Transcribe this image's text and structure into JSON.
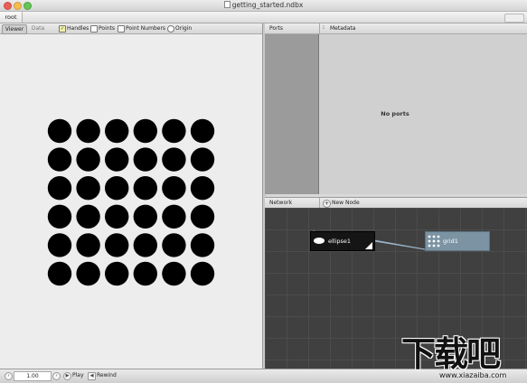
{
  "window": {
    "title": "getting_started.ndbx"
  },
  "pathbar": {
    "root": "root"
  },
  "viewer": {
    "tabs": [
      "Viewer",
      "Data"
    ],
    "options": [
      {
        "label": "Handles",
        "checked": true
      },
      {
        "label": "Points",
        "checked": false
      },
      {
        "label": "Point Numbers",
        "checked": false
      },
      {
        "label": "Origin",
        "checked": false
      }
    ],
    "grid": {
      "rows": 6,
      "cols": 6,
      "color": "#000000"
    }
  },
  "ports_panel": {
    "ports_label": "Ports",
    "metadata_label": "Metadata",
    "empty_message": "No ports"
  },
  "network": {
    "label": "Network",
    "new_node_label": "New Node",
    "nodes": [
      {
        "name": "ellipse1"
      },
      {
        "name": "grid1"
      }
    ]
  },
  "playback": {
    "frame": "1.00",
    "play_label": "Play",
    "rewind_label": "Rewind"
  },
  "watermark": {
    "title": "下载吧",
    "url": "www.xiazaiba.com"
  },
  "colors": {
    "canvas": "#ededed",
    "network_bg": "#404040",
    "grid_node": "#7b93a3",
    "connection": "#9ab3c8"
  }
}
